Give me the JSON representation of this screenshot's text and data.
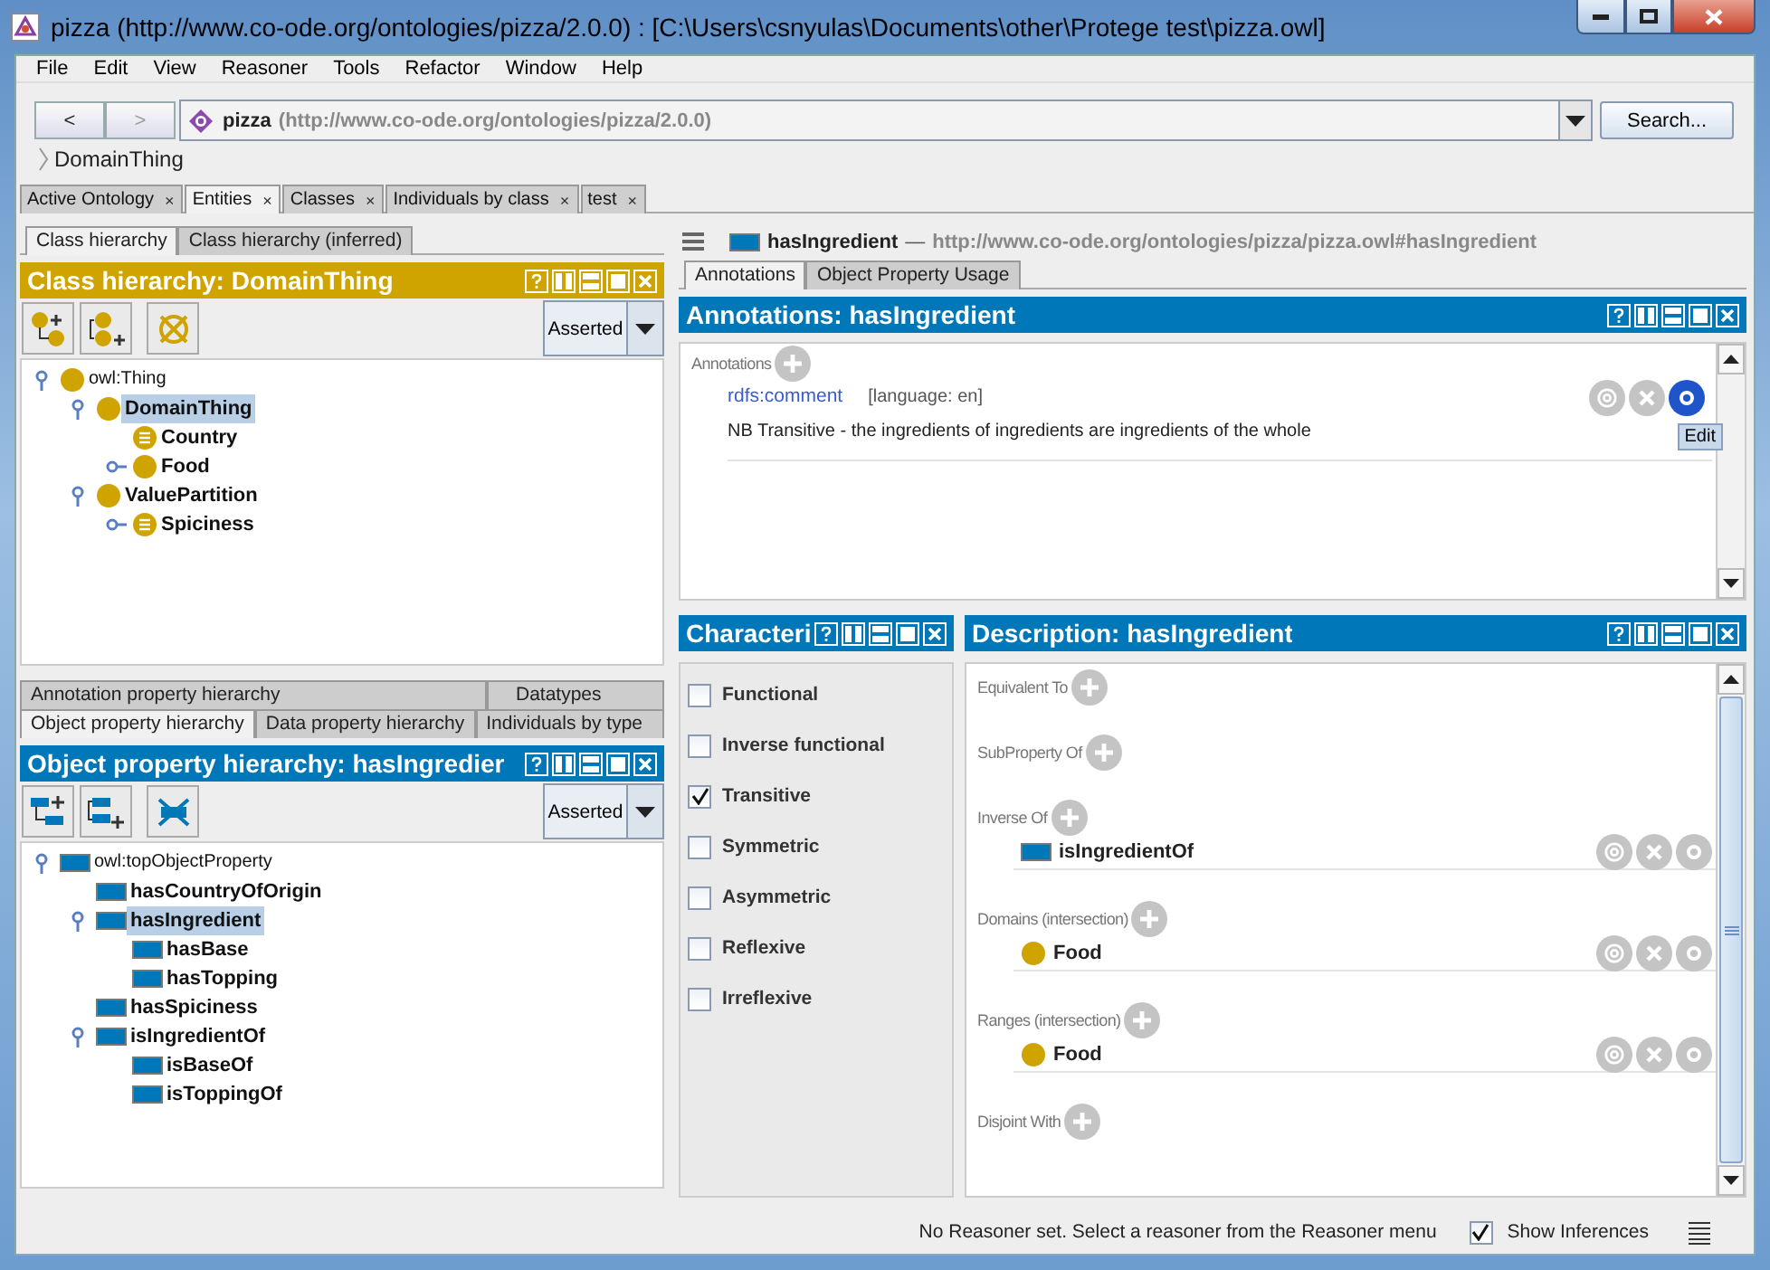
{
  "window": {
    "title": "pizza (http://www.co-ode.org/ontologies/pizza/2.0.0)  : [C:\\Users\\csnyulas\\Documents\\other\\Protege test\\pizza.owl]"
  },
  "menu": [
    "File",
    "Edit",
    "View",
    "Reasoner",
    "Tools",
    "Refactor",
    "Window",
    "Help"
  ],
  "nav": {
    "back": "<",
    "forward": ">",
    "ontology_name": "pizza",
    "ontology_iri": "(http://www.co-ode.org/ontologies/pizza/2.0.0)",
    "search": "Search..."
  },
  "breadcrumb": "DomainThing",
  "workspace_tabs": [
    {
      "label": "Active Ontology",
      "close": "×",
      "selected": false
    },
    {
      "label": "Entities",
      "close": "×",
      "selected": true
    },
    {
      "label": "Classes",
      "close": "×",
      "selected": false
    },
    {
      "label": "Individuals by class",
      "close": "×",
      "selected": false
    },
    {
      "label": "test",
      "close": "×",
      "selected": false
    }
  ],
  "class_panel": {
    "tabs": [
      {
        "label": "Class hierarchy",
        "selected": true
      },
      {
        "label": "Class hierarchy (inferred)",
        "selected": false
      }
    ],
    "title": "Class hierarchy: DomainThing",
    "mode": "Asserted",
    "tree": [
      {
        "label": "owl:Thing",
        "kind": "class",
        "selected": false,
        "expanded": true,
        "children": [
          {
            "label": "DomainThing",
            "kind": "class",
            "selected": true,
            "expanded": true,
            "children": [
              {
                "label": "Country",
                "kind": "defined_class",
                "selected": false
              },
              {
                "label": "Food",
                "kind": "class",
                "selected": false,
                "expanded": false
              }
            ]
          },
          {
            "label": "ValuePartition",
            "kind": "class",
            "selected": false,
            "expanded": true,
            "children": [
              {
                "label": "Spiciness",
                "kind": "defined_class",
                "selected": false,
                "expanded": false
              }
            ]
          }
        ]
      }
    ]
  },
  "property_panel": {
    "tabs_top": [
      {
        "label": "Annotation property hierarchy",
        "selected": false
      },
      {
        "label": "Datatypes",
        "selected": false
      }
    ],
    "tabs_bottom": [
      {
        "label": "Object property hierarchy",
        "selected": true
      },
      {
        "label": "Data property hierarchy",
        "selected": false
      },
      {
        "label": "Individuals by type",
        "selected": false
      }
    ],
    "title": "Object property hierarchy: hasIngredier",
    "mode": "Asserted",
    "tree": [
      {
        "label": "owl:topObjectProperty",
        "kind": "property",
        "selected": false,
        "expanded": true,
        "children": [
          {
            "label": "hasCountryOfOrigin",
            "kind": "property",
            "selected": false
          },
          {
            "label": "hasIngredient",
            "kind": "property",
            "selected": true,
            "expanded": true,
            "children": [
              {
                "label": "hasBase",
                "kind": "property",
                "selected": false
              },
              {
                "label": "hasTopping",
                "kind": "property",
                "selected": false
              }
            ]
          },
          {
            "label": "hasSpiciness",
            "kind": "property",
            "selected": false
          },
          {
            "label": "isIngredientOf",
            "kind": "property",
            "selected": false,
            "expanded": true,
            "children": [
              {
                "label": "isBaseOf",
                "kind": "property",
                "selected": false
              },
              {
                "label": "isToppingOf",
                "kind": "property",
                "selected": false
              }
            ]
          }
        ]
      }
    ]
  },
  "entity": {
    "name": "hasIngredient",
    "separator": "—",
    "iri": "http://www.co-ode.org/ontologies/pizza/pizza.owl#hasIngredient"
  },
  "entity_tabs": [
    {
      "label": "Annotations",
      "selected": true
    },
    {
      "label": "Object Property Usage",
      "selected": false
    }
  ],
  "annotations": {
    "title": "Annotations: hasIngredient",
    "section": "Annotations",
    "items": [
      {
        "property": "rdfs:comment",
        "language": "[language: en]",
        "value": "NB Transitive - the ingredients of ingredients are ingredients of the whole",
        "edit_hovered": true,
        "tooltip": "Edit"
      }
    ]
  },
  "characteristics": {
    "title": "Characteri",
    "items": [
      {
        "label": "Functional",
        "checked": false
      },
      {
        "label": "Inverse functional",
        "checked": false
      },
      {
        "label": "Transitive",
        "checked": true
      },
      {
        "label": "Symmetric",
        "checked": false
      },
      {
        "label": "Asymmetric",
        "checked": false
      },
      {
        "label": "Reflexive",
        "checked": false
      },
      {
        "label": "Irreflexive",
        "checked": false
      }
    ]
  },
  "description": {
    "title": "Description: hasIngredient",
    "sections": [
      {
        "label": "Equivalent To"
      },
      {
        "label": "SubProperty Of"
      },
      {
        "label": "Inverse Of",
        "items": [
          {
            "label": "isIngredientOf",
            "kind": "property"
          }
        ]
      },
      {
        "label": "Domains (intersection)",
        "items": [
          {
            "label": "Food",
            "kind": "class"
          }
        ]
      },
      {
        "label": "Ranges (intersection)",
        "items": [
          {
            "label": "Food",
            "kind": "class"
          }
        ]
      },
      {
        "label": "Disjoint With"
      }
    ]
  },
  "status": {
    "message": "No Reasoner set. Select a reasoner from the Reasoner menu",
    "show_inferences": {
      "label": "Show Inferences",
      "checked": true
    }
  }
}
